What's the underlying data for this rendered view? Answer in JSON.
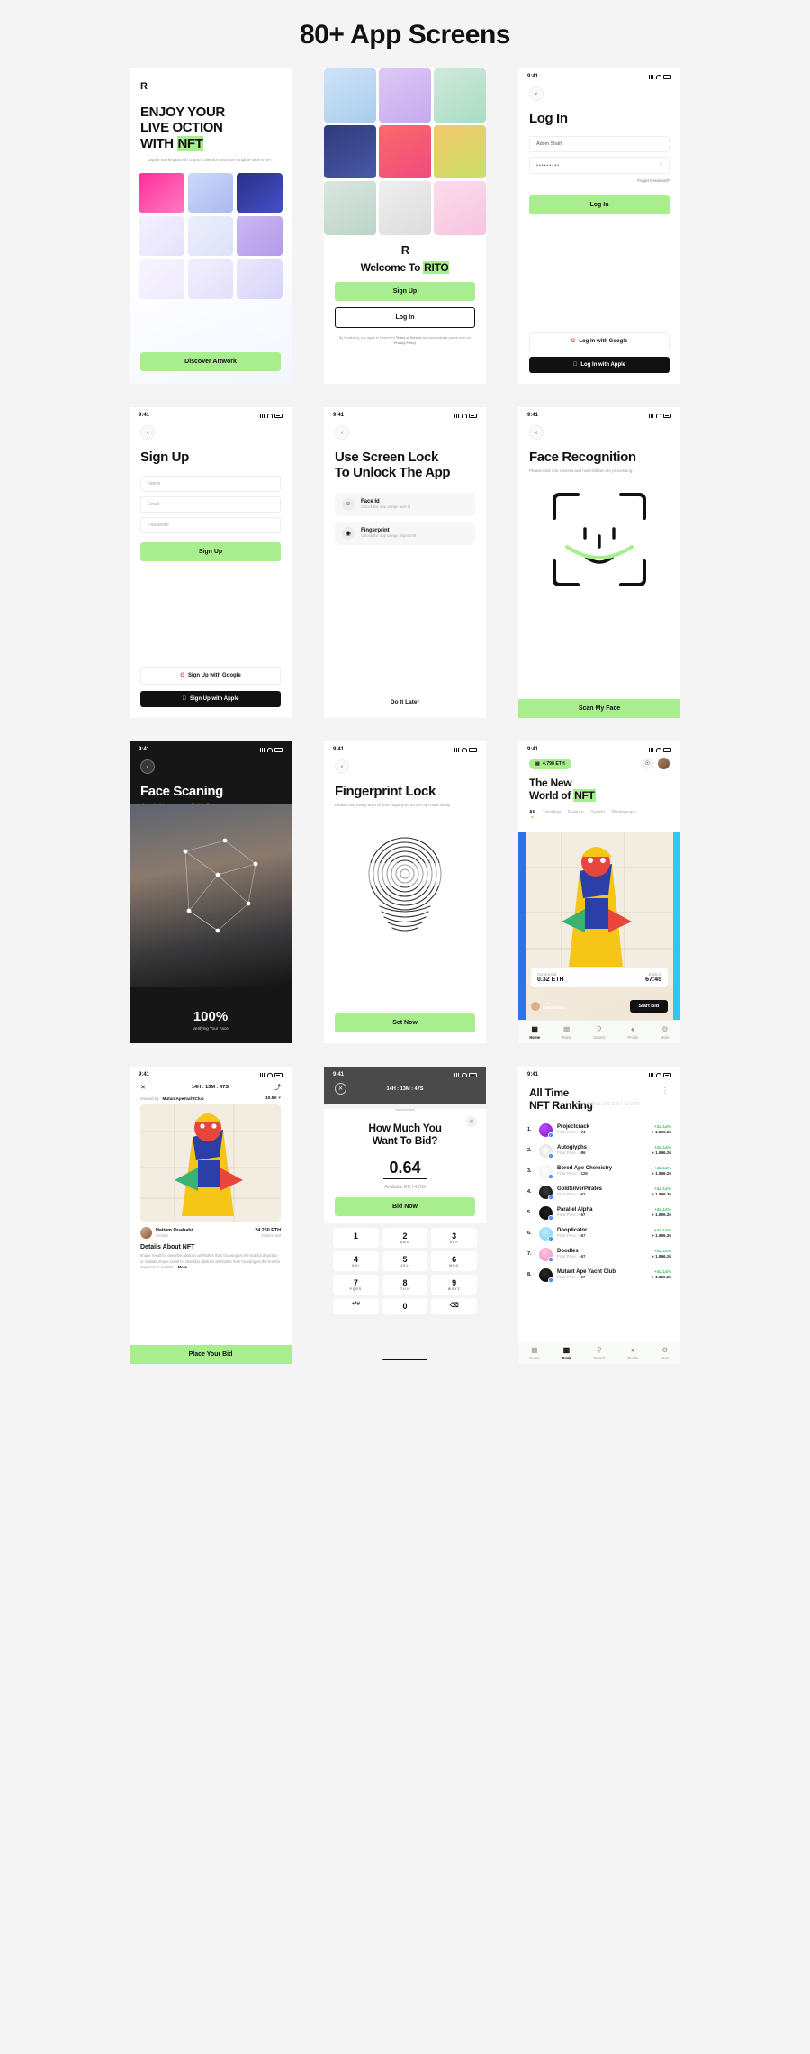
{
  "page": {
    "title": "80+ App Screens",
    "watermark": "www.zcool.com"
  },
  "common": {
    "time": "9:41",
    "back_icon": "‹"
  },
  "screens": {
    "onboarding": {
      "logo": "R",
      "title_l1": "ENJOY YOUR",
      "title_l2": "LIVE OCTION",
      "title_l3_pre": "WITH ",
      "title_l3_hl": "NFT",
      "subtitle": "Digital marketplace fo crypto collection and non fungible tokens  NFT",
      "cta": "Discover Artwork",
      "tiles": [
        "#ff2d9b",
        "#cfd8f7",
        "#23308f",
        "#f2f0ff",
        "#eef0fb",
        "#c9b6f2",
        "#f8f3ff",
        "#f0eefc",
        "#e8e6fb"
      ]
    },
    "welcome": {
      "logo": "R",
      "title_pre": "Welcome To ",
      "title_hl": "RITO",
      "signup": "Sign Up",
      "login": "Log In",
      "legal_pre": "By Continuing, you agree to Pinterest's ",
      "legal_tos": "Terms of Service",
      "legal_mid": " and acknowledge you've read our ",
      "legal_privacy": "Privacy Policy",
      "tiles": [
        "#cfe3f7",
        "#d9c9f2",
        "#cfeadb",
        "#2f3b7a",
        "#fa6a6a",
        "#f5c86b",
        "#bfe0d0",
        "#e8e8e8",
        "#f9d8e8"
      ]
    },
    "login": {
      "heading": "Log In",
      "name_value": "Adom Shafi",
      "password_value": "•••••••••",
      "eye_icon": "⌾",
      "forgot": "Forget Password?",
      "cta": "Log In",
      "google": "Log In with Google",
      "apple": "Log In with Apple",
      "google_icon": "G",
      "apple_icon": ""
    },
    "signup": {
      "heading": "Sign Up",
      "name_placeholder": "Name",
      "email_placeholder": "Email",
      "password_placeholder": "Password",
      "cta": "Sign Up",
      "google": "Sign Up with Google",
      "apple": "Sign Up with Apple",
      "google_icon": "G",
      "apple_icon": ""
    },
    "screenlock": {
      "title_l1": "Use Screen Lock",
      "title_l2": "To Unlock The App",
      "options": [
        {
          "name": "Face Id",
          "desc": "Unlock the app useign face-id",
          "icon": "☺"
        },
        {
          "name": "Fingerprint",
          "desc": "Unlock the app useign fingerprint",
          "icon": "◉"
        }
      ],
      "skip": "Do It Later"
    },
    "facerecog": {
      "heading": "Face Recognition",
      "subtitle": "Please look into camera and hold still we are processing",
      "cta": "Scan My Face"
    },
    "facescan": {
      "heading": "Face Scaning",
      "subtitle": "Please look into camera and hold still we are processing",
      "percent": "100%",
      "status": "Verifying Your Face"
    },
    "fingerprint": {
      "heading": "Fingerprint Lock",
      "subtitle": "Please use every area of your fingerprint so we can read easily",
      "cta": "Set Now"
    },
    "home": {
      "balance": "4.798 ETH",
      "wallet_icon": "▤",
      "bell_icon": "☉",
      "title_l1": "The New",
      "title_l2_pre": "World of ",
      "title_l2_hl": "NFT",
      "tabs": [
        "All",
        "Trending",
        "Feature",
        "Sports",
        "Photograph"
      ],
      "active_tab": "All",
      "bid_label": "Current Bid",
      "bid_value": "0.32 ETH",
      "ends_label": "Ends in",
      "ends_value": "67:45",
      "artist_label": "Artist",
      "artist_name": "@markrise",
      "cta": "Start Bid",
      "navbar": [
        "Home",
        "Rank",
        "Search",
        "Profile",
        "More"
      ],
      "nav_active": "Home"
    },
    "details": {
      "timer": "14H : 13M : 47S",
      "close_icon": "✕",
      "share_icon": "⤴",
      "owned_label": "Owned by :",
      "owner": "MutantApeYachtClub",
      "likes": "10.5K",
      "heart_icon": "♥",
      "bidder_name": "Haitam Ouahabi",
      "bidder_role": "Creator",
      "bid_amount": "24.250 ETH",
      "bid_label": "Highest Bid",
      "section_title": "Details About NFT",
      "description": "Image result for describe abstract art Rather than focusing on the truthful depiction or realistic image result for describe abstract art Rather than focusing on the truthful depiction or realistic",
      "more": "... More",
      "cta": "Place Your Bid"
    },
    "bid": {
      "timer": "14H : 13M : 47S",
      "close_icon": "✕",
      "dismiss_icon": "✕",
      "title_l1": "How Much You",
      "title_l2": "Want To Bid?",
      "amount": "0.64",
      "available": "Available ETH 4.789",
      "cta": "Bid Now",
      "keys": [
        {
          "d": "1",
          "s": ""
        },
        {
          "d": "2",
          "s": "ABC"
        },
        {
          "d": "3",
          "s": "DEF"
        },
        {
          "d": "4",
          "s": "GHI"
        },
        {
          "d": "5",
          "s": "JKL"
        },
        {
          "d": "6",
          "s": "MNO"
        },
        {
          "d": "7",
          "s": "PQRS"
        },
        {
          "d": "8",
          "s": "TUV"
        },
        {
          "d": "9",
          "s": "WXYZ"
        },
        {
          "d": "+*#",
          "s": ""
        },
        {
          "d": "0",
          "s": ""
        },
        {
          "d": "⌫",
          "s": ""
        }
      ]
    },
    "ranking": {
      "title_l1": "All Time",
      "title_l2": "NFT Ranking",
      "menu_icon": "⋮",
      "rows": [
        {
          "rank": "1.",
          "name": "Projectcrack",
          "fp_label": "Floor Price :",
          "fp": "74",
          "pct": "+43.14%",
          "vol": "1.896.26",
          "color": "#9b2ff5"
        },
        {
          "rank": "2.",
          "name": "Autoglyphs",
          "fp_label": "Floor Price :",
          "fp": "86",
          "pct": "+42.14%",
          "vol": "1.896.26",
          "color": "#e6e6e6"
        },
        {
          "rank": "3.",
          "name": "Bored Ape Chemistry",
          "fp_label": "Floor Price :",
          "fp": "126",
          "pct": "+42.14%",
          "vol": "1.896.26",
          "color": "#f2f2f2"
        },
        {
          "rank": "4.",
          "name": "GoldSilverPirates",
          "fp_label": "Floor Price :",
          "fp": "67",
          "pct": "+42.14%",
          "vol": "1.896.26",
          "color": "#161616"
        },
        {
          "rank": "5.",
          "name": "Parallel Alpha",
          "fp_label": "Floor Price :",
          "fp": "67",
          "pct": "+42.14%",
          "vol": "1.896.26",
          "color": "#0b0b0b"
        },
        {
          "rank": "6.",
          "name": "Dooplicator",
          "fp_label": "Floor Price :",
          "fp": "67",
          "pct": "+42.14%",
          "vol": "1.896.26",
          "color": "#8fd8f0"
        },
        {
          "rank": "7.",
          "name": "Doodles",
          "fp_label": "Floor Price :",
          "fp": "67",
          "pct": "+42.14%",
          "vol": "1.896.26",
          "color": "#f79bc4"
        },
        {
          "rank": "8.",
          "name": "Mutant Ape Yacht Club",
          "fp_label": "Floor Price :",
          "fp": "67",
          "pct": "+42.14%",
          "vol": "1.896.26",
          "color": "#111111"
        }
      ],
      "eth_icon": "♦",
      "navbar": [
        "Home",
        "Rank",
        "Search",
        "Profile",
        "More"
      ],
      "nav_active": "Rank"
    }
  }
}
